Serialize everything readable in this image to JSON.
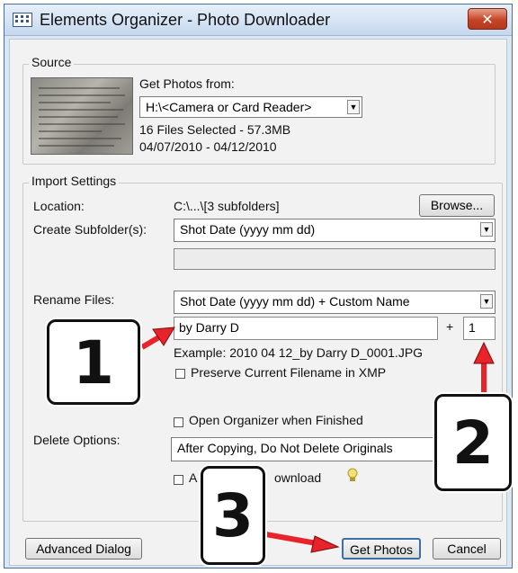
{
  "window": {
    "title": "Elements Organizer - Photo Downloader",
    "close_symbol": "✕"
  },
  "source": {
    "legend": "Source",
    "get_photos_from_label": "Get Photos from:",
    "device_value": "H:\\<Camera or Card Reader>",
    "files_selected": "16 Files Selected - 57.3MB",
    "date_range": "04/07/2010 - 04/12/2010"
  },
  "import": {
    "legend": "Import Settings",
    "location_label": "Location:",
    "location_value": "C:\\...\\[3 subfolders]",
    "browse_label": "Browse...",
    "create_subfolder_label": "Create Subfolder(s):",
    "subfolder_value": "Shot Date (yyyy mm dd)",
    "custom_subfolder_value": "",
    "rename_label": "Rename Files:",
    "rename_value": "Shot Date (yyyy mm dd) + Custom Name",
    "custom_name_value": "by Darry D",
    "plus": "+",
    "start_number_value": "1",
    "example_text": "Example:  2010 04 12_by Darry D_0001.JPG",
    "preserve_label": "Preserve Current Filename in XMP",
    "open_organizer_label": "Open Organizer when Finished",
    "delete_options_label": "Delete Options:",
    "delete_value": "After Copying, Do Not Delete Originals",
    "auto_download_label_start": "A",
    "auto_download_label_end": "ownload"
  },
  "buttons": {
    "advanced_label": "Advanced Dialog",
    "get_photos_label": "Get Photos",
    "cancel_label": "Cancel"
  },
  "callouts": {
    "one": "1",
    "two": "2",
    "three": "3"
  },
  "colors": {
    "arrow": "#e8232a",
    "close_button": "#c54426"
  }
}
